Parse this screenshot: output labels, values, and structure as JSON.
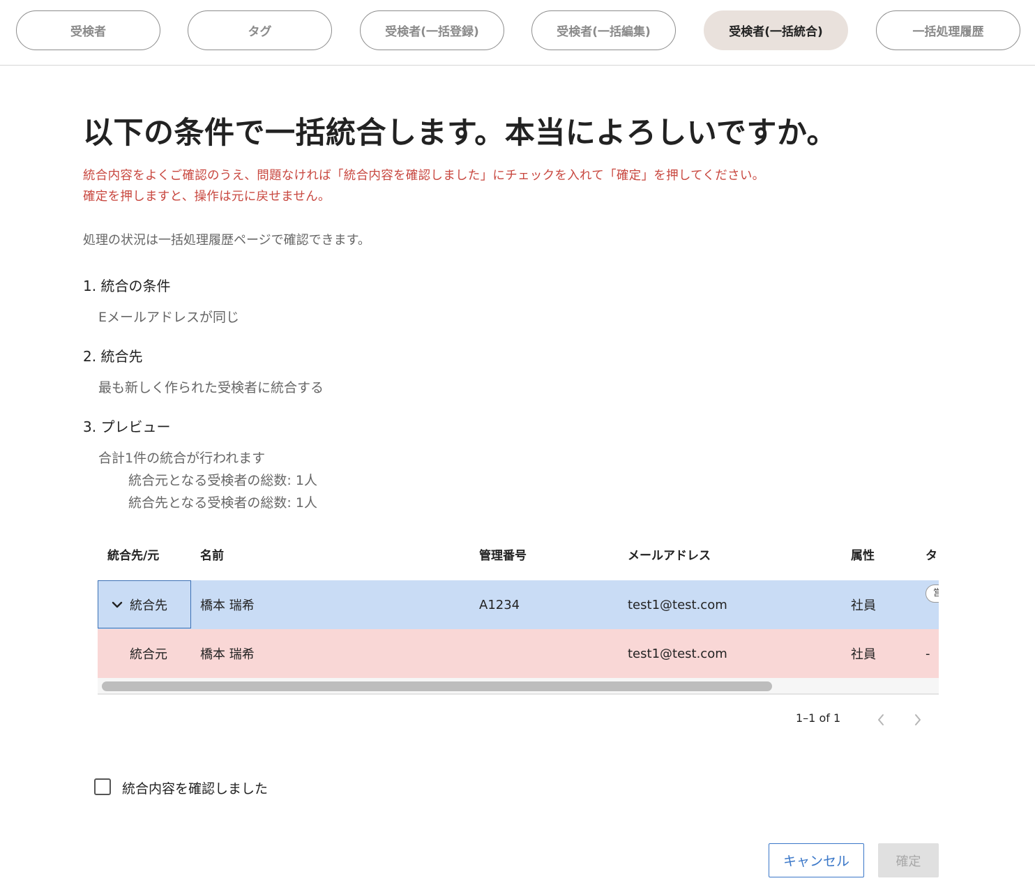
{
  "tabs": [
    {
      "label": "受検者"
    },
    {
      "label": "タグ"
    },
    {
      "label": "受検者(一括登録)"
    },
    {
      "label": "受検者(一括編集)"
    },
    {
      "label": "受検者(一括統合)"
    },
    {
      "label": "一括処理履歴"
    }
  ],
  "active_tab": "受検者(一括統合)",
  "page": {
    "title": "以下の条件で一括統合します。本当によろしいですか。",
    "warning_line1": "統合内容をよくご確認のうえ、問題なければ「統合内容を確認しました」にチェックを入れて「確定」を押してください。",
    "warning_line2": "確定を押しますと、操作は元に戻せません。",
    "note": "処理の状況は一括処理履歴ページで確認できます。"
  },
  "sections": {
    "condition": {
      "heading": "1. 統合の条件",
      "body": "Eメールアドレスが同じ"
    },
    "destination": {
      "heading": "2. 統合先",
      "body": "最も新しく作られた受検者に統合する"
    },
    "preview": {
      "heading": "3. プレビュー",
      "summary": "合計1件の統合が行われます",
      "source_total": "統合元となる受検者の総数: 1人",
      "dest_total": "統合先となる受検者の総数: 1人"
    }
  },
  "table": {
    "headers": {
      "role": "統合先/元",
      "name": "名前",
      "management_no": "管理番号",
      "email": "メールアドレス",
      "attribute": "属性",
      "tag": "タ"
    },
    "rows": [
      {
        "role": "統合先",
        "name": "橋本 瑞希",
        "management_no": "A1234",
        "email": "test1@test.com",
        "attribute": "社員",
        "tag": "営"
      },
      {
        "role": "統合元",
        "name": "橋本 瑞希",
        "management_no": "",
        "email": "test1@test.com",
        "attribute": "社員",
        "tag": "-"
      }
    ]
  },
  "pagination": {
    "text": "1–1 of 1"
  },
  "confirm_checkbox": {
    "label": "統合内容を確認しました",
    "checked": false
  },
  "buttons": {
    "cancel": "キャンセル",
    "confirm": "確定"
  },
  "colors": {
    "active_tab_bg": "#e9e1dc",
    "warning_text": "#c8473f",
    "dest_row_bg": "#c9dcf5",
    "src_row_bg": "#f9d7d6",
    "primary_blue": "#3a77c8"
  },
  "icons": {
    "expand": "chevron-down-icon",
    "prev": "chevron-left-icon",
    "next": "chevron-right-icon"
  }
}
